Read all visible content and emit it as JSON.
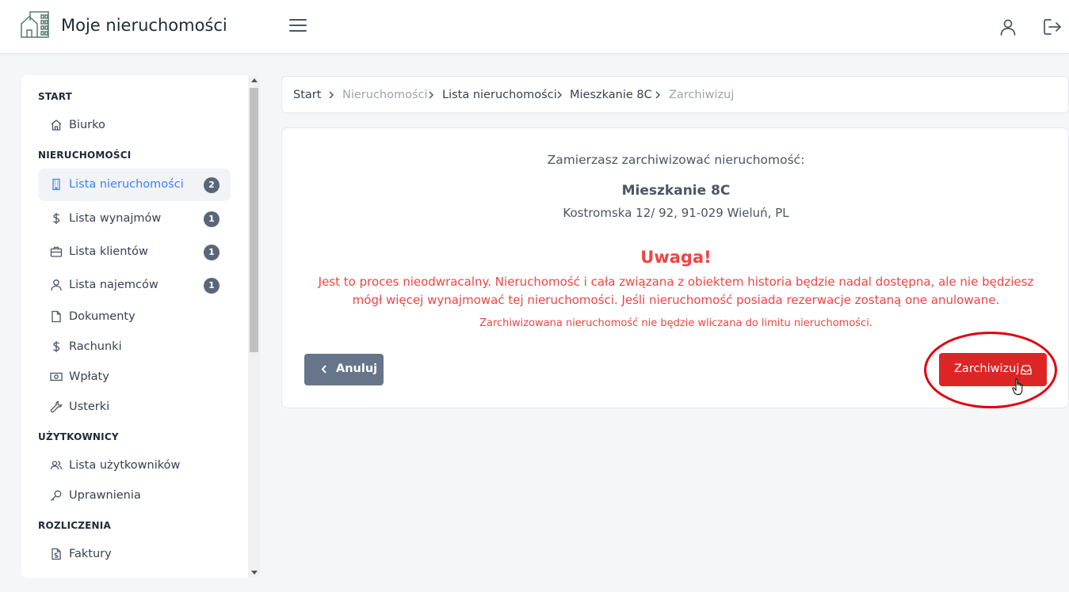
{
  "header": {
    "app_title": "Moje nieruchomości",
    "logo_icon": "house-building-logo-icon",
    "menu_icon": "hamburger-menu-icon",
    "user_icon": "user-icon",
    "logout_icon": "logout-icon"
  },
  "sidebar": {
    "sections": {
      "start": "START",
      "properties": "NIERUCHOMOŚCI",
      "users": "UŻYTKOWNICY",
      "billing": "ROZLICZENIA"
    },
    "items": [
      {
        "label": "Biurko",
        "icon": "home-icon",
        "badge": ""
      },
      {
        "label": "Lista nieruchomości",
        "icon": "building-icon",
        "badge": "2",
        "active": true
      },
      {
        "label": "Lista wynajmów",
        "icon": "dollar-icon",
        "badge": "1"
      },
      {
        "label": "Lista klientów",
        "icon": "briefcase-icon",
        "badge": "1"
      },
      {
        "label": "Lista najemców",
        "icon": "user-icon",
        "badge": "1"
      },
      {
        "label": "Dokumenty",
        "icon": "document-icon",
        "badge": ""
      },
      {
        "label": "Rachunki",
        "icon": "dollar-icon",
        "badge": ""
      },
      {
        "label": "Wpłaty",
        "icon": "banknote-icon",
        "badge": ""
      },
      {
        "label": "Usterki",
        "icon": "wrench-icon",
        "badge": ""
      },
      {
        "label": "Lista użytkowników",
        "icon": "users-icon",
        "badge": ""
      },
      {
        "label": "Uprawnienia",
        "icon": "key-icon",
        "badge": ""
      },
      {
        "label": "Faktury",
        "icon": "invoice-icon",
        "badge": ""
      }
    ]
  },
  "breadcrumb": {
    "items": [
      "Start",
      "Nieruchomości",
      "Lista nieruchomości",
      "Mieszkanie 8C",
      "Zarchiwizuj"
    ]
  },
  "dialog": {
    "question": "Zamierzasz zarchiwizować nieruchomość:",
    "property_name": "Mieszkanie 8C",
    "property_address": "Kostromska 12/ 92, 91-029 Wieluń, PL",
    "warning_title": "Uwaga!",
    "warning_text": "Jest to proces nieodwracalny. Nieruchomość i cała związana z obiektem historia będzie nadal dostępna, ale nie będziesz mógł więcej wynajmować tej nieruchomości. Jeśli nieruchomość posiada rezerwacje zostaną one anulowane.",
    "warning_note": "Zarchiwizowana nieruchomość nie będzie wliczana do limitu nieruchomości.",
    "cancel_label": "Anuluj",
    "archive_label": "Zarchiwizuj"
  },
  "colors": {
    "accent": "#3b82f6",
    "danger": "#dc2626",
    "badge": "#5a6678",
    "cancel_button": "#66758a",
    "highlight": "#e0000f"
  }
}
